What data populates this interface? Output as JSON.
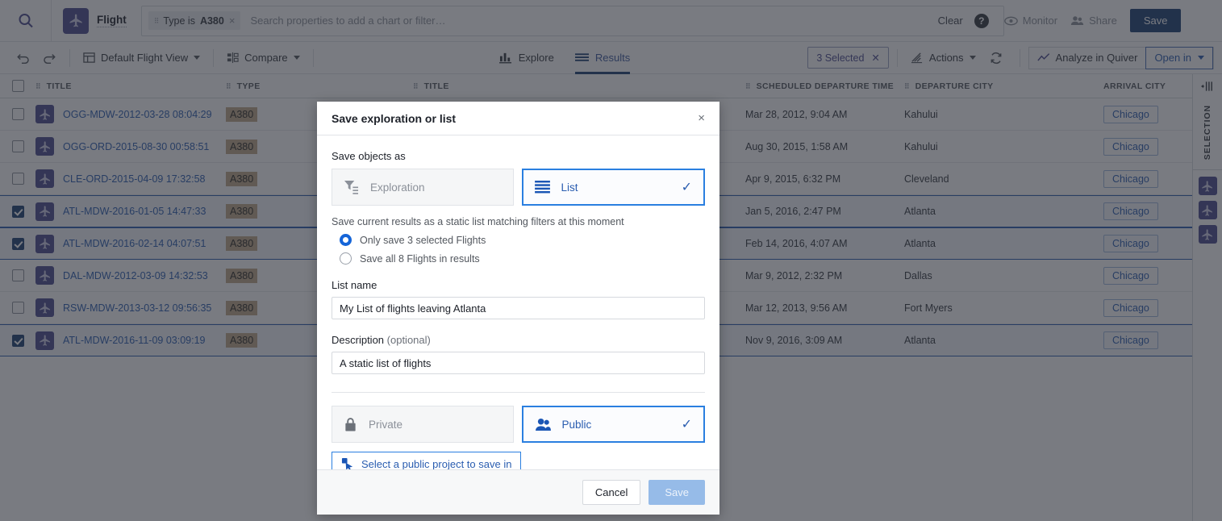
{
  "topbar": {
    "search_icon": "search-icon",
    "app_icon": "airplane-icon",
    "app_name": "Flight",
    "filter_chip": {
      "prefix": "Type is",
      "value": "A380",
      "remove": "×"
    },
    "search_placeholder": "Search properties to add a chart or filter…",
    "clear_label": "Clear",
    "help_label": "?",
    "monitor_label": "Monitor",
    "share_label": "Share",
    "save_label": "Save"
  },
  "toolbar": {
    "undo_icon": "undo-icon",
    "redo_icon": "redo-icon",
    "view_label": "Default Flight View",
    "compare_label": "Compare",
    "tabs": [
      {
        "label": "Explore",
        "icon": "bar-chart-icon",
        "active": false
      },
      {
        "label": "Results",
        "icon": "list-icon",
        "active": true
      }
    ],
    "selected_pill": "3 Selected",
    "selected_pill_clear": "✕",
    "actions_label": "Actions",
    "refresh_icon": "refresh-icon",
    "analyze_label": "Analyze in Quiver",
    "open_in_label": "Open in"
  },
  "table": {
    "columns": [
      "TITLE",
      "TYPE",
      "TITLE",
      "SCHEDULED DEPARTURE TIME",
      "DEPARTURE CITY",
      "ARRIVAL CITY"
    ],
    "settings_icon": "gear-icon",
    "rows": [
      {
        "selected": false,
        "title": "OGG-MDW-2012-03-28 08:04:29",
        "type": "A380",
        "departure_time": "Mar 28, 2012, 9:04 AM",
        "departure_city": "Kahului",
        "arrival_city": "Chicago"
      },
      {
        "selected": false,
        "title": "OGG-ORD-2015-08-30 00:58:51",
        "type": "A380",
        "departure_time": "Aug 30, 2015, 1:58 AM",
        "departure_city": "Kahului",
        "arrival_city": "Chicago"
      },
      {
        "selected": false,
        "title": "CLE-ORD-2015-04-09 17:32:58",
        "type": "A380",
        "departure_time": "Apr 9, 2015, 6:32 PM",
        "departure_city": "Cleveland",
        "arrival_city": "Chicago"
      },
      {
        "selected": true,
        "title": "ATL-MDW-2016-01-05 14:47:33",
        "type": "A380",
        "departure_time": "Jan 5, 2016, 2:47 PM",
        "departure_city": "Atlanta",
        "arrival_city": "Chicago"
      },
      {
        "selected": true,
        "title": "ATL-MDW-2016-02-14 04:07:51",
        "type": "A380",
        "departure_time": "Feb 14, 2016, 4:07 AM",
        "departure_city": "Atlanta",
        "arrival_city": "Chicago"
      },
      {
        "selected": false,
        "title": "DAL-MDW-2012-03-09 14:32:53",
        "type": "A380",
        "departure_time": "Mar 9, 2012, 2:32 PM",
        "departure_city": "Dallas",
        "arrival_city": "Chicago"
      },
      {
        "selected": false,
        "title": "RSW-MDW-2013-03-12 09:56:35",
        "type": "A380",
        "departure_time": "Mar 12, 2013, 9:56 AM",
        "departure_city": "Fort Myers",
        "arrival_city": "Chicago"
      },
      {
        "selected": true,
        "title": "ATL-MDW-2016-11-09 03:09:19",
        "type": "A380",
        "departure_time": "Nov 9, 2016, 3:09 AM",
        "departure_city": "Atlanta",
        "arrival_city": "Chicago"
      }
    ]
  },
  "rail": {
    "collapse_icon": "collapse-panel-icon",
    "label": "SELECTION",
    "item_count": 3
  },
  "modal": {
    "title": "Save exploration or list",
    "close": "×",
    "save_objects_as_label": "Save objects as",
    "object_types": [
      {
        "label": "Exploration",
        "icon": "filter-list-icon",
        "selected": false
      },
      {
        "label": "List",
        "icon": "list-lines-icon",
        "selected": true,
        "check": "✓"
      }
    ],
    "static_hint": "Save current results as a static list matching filters at this moment",
    "radios": [
      {
        "label": "Only save 3 selected Flights",
        "selected": true
      },
      {
        "label": "Save all 8 Flights in results",
        "selected": false
      }
    ],
    "list_name_label": "List name",
    "list_name_value": "My List of flights leaving Atlanta",
    "description_label": "Description",
    "description_optional": "(optional)",
    "description_value": "A static list of flights",
    "visibility": [
      {
        "label": "Private",
        "icon": "lock-icon",
        "selected": false
      },
      {
        "label": "Public",
        "icon": "people-icon",
        "selected": true,
        "check": "✓"
      }
    ],
    "project_button": "Select a public project to save in",
    "project_icon": "cursor-select-icon",
    "cancel_label": "Cancel",
    "save_label": "Save"
  },
  "colors": {
    "accent": "#2a5db0",
    "brand_purple": "#4b4b8f",
    "save_primary": "#1b3f72",
    "type_chip": "#bfa98a"
  }
}
